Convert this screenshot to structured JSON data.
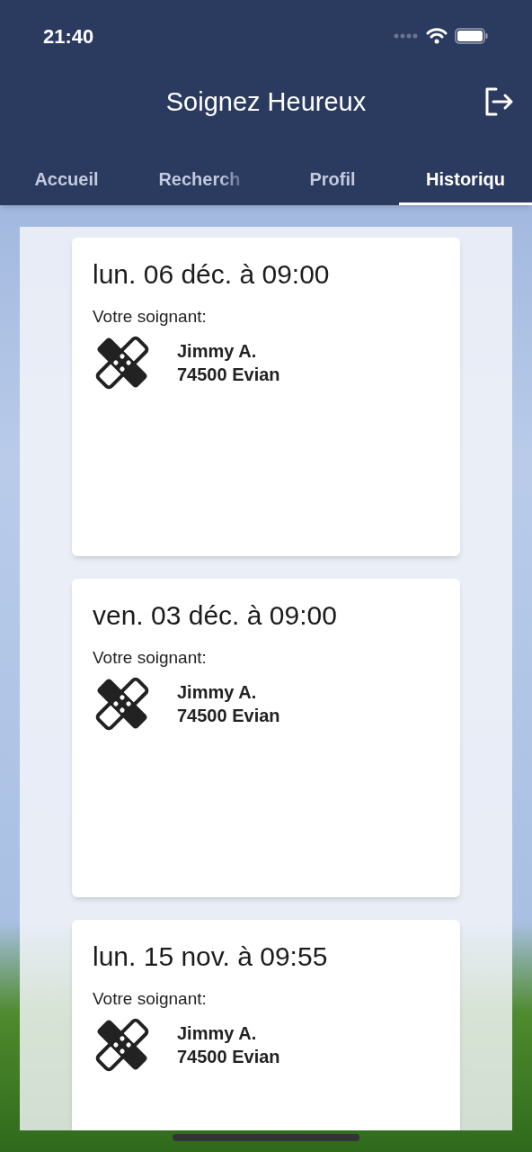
{
  "status_bar": {
    "time": "21:40"
  },
  "header": {
    "title": "Soignez Heureux"
  },
  "tabs": [
    {
      "label": "Accueil",
      "selected": false,
      "faded": false
    },
    {
      "label": "Recherch",
      "selected": false,
      "faded": true
    },
    {
      "label": "Profil",
      "selected": false,
      "faded": false
    },
    {
      "label": "Historiqu",
      "selected": true,
      "faded": false
    }
  ],
  "appointments": [
    {
      "date": "lun. 06 déc. à 09:00",
      "caregiver_label": "Votre soignant:",
      "name": "Jimmy A.",
      "location": "74500 Evian"
    },
    {
      "date": "ven. 03 déc. à 09:00",
      "caregiver_label": "Votre soignant:",
      "name": "Jimmy A.",
      "location": "74500 Evian"
    },
    {
      "date": "lun. 15 nov. à 09:55",
      "caregiver_label": "Votre soignant:",
      "name": "Jimmy A.",
      "location": "74500 Evian"
    }
  ]
}
